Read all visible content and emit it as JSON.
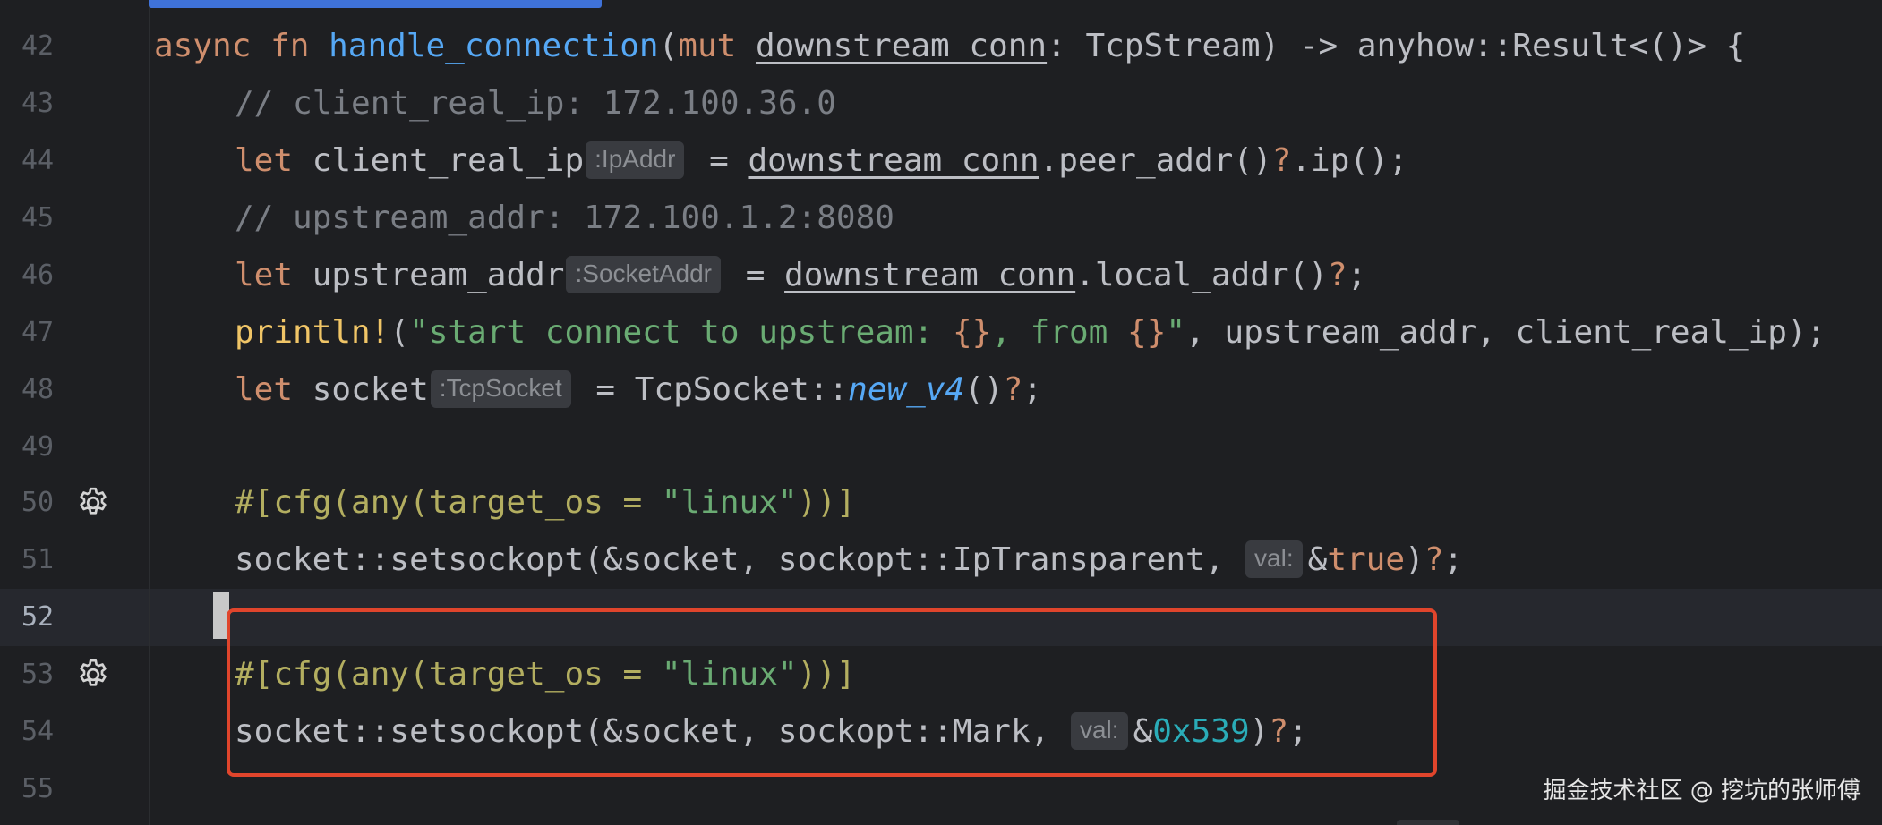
{
  "editor": {
    "line_numbers": [
      "42",
      "43",
      "44",
      "45",
      "46",
      "47",
      "48",
      "49",
      "50",
      "51",
      "52",
      "53",
      "54",
      "55"
    ],
    "current_line": "52",
    "accent_colors": {
      "highlight_box": "#e0452c",
      "scroll_indicator": "#3f72d9"
    },
    "icons": [
      "gear-icon",
      "gear-icon"
    ]
  },
  "code": {
    "l42": {
      "kw1": "async",
      "kw2": "fn",
      "fn": "handle_connection",
      "p1": "(",
      "kw3": "mut",
      "param": "downstream_conn",
      "rest": ": TcpStream) -> anyhow::Result<()> {"
    },
    "l43": {
      "comment": "// client_real_ip: 172.100.36.0"
    },
    "l44": {
      "kw": "let",
      "name": "client_real_ip",
      "hint": ":IpAddr",
      "eq": " = ",
      "recv": "downstream_conn",
      "rest1": ".peer_addr()",
      "q1": "?",
      "rest2": ".ip();"
    },
    "l45": {
      "comment": "// upstream_addr: 172.100.1.2:8080"
    },
    "l46": {
      "kw": "let",
      "name": "upstream_addr",
      "hint": ":SocketAddr",
      "eq": " = ",
      "recv": "downstream_conn",
      "rest1": ".local_addr()",
      "q1": "?",
      "rest2": ";"
    },
    "l47": {
      "macro": "println!",
      "p1": "(",
      "s1": "\"start connect to upstream: ",
      "b1": "{}",
      "s2": ", from ",
      "b2": "{}",
      "s3": "\"",
      "rest": ", upstream_addr, client_real_ip);"
    },
    "l48": {
      "kw": "let",
      "name": "socket",
      "hint": ":TcpSocket",
      "eq": " = TcpSocket::",
      "fn": "new_v4",
      "rest1": "()",
      "q1": "?",
      "rest2": ";"
    },
    "l50": {
      "attr1": "#[cfg(any(target_os = ",
      "str": "\"linux\"",
      "attr2": "))]"
    },
    "l51": {
      "pre": "socket::setsockopt(&socket, sockopt::IpTransparent, ",
      "hint": "val:",
      "amp": "&",
      "kw": "true",
      "rest": ")",
      "q1": "?",
      "end": ";"
    },
    "l53": {
      "attr1": "#[cfg(any(target_os = ",
      "str": "\"linux\"",
      "attr2": "))]"
    },
    "l54": {
      "pre": "socket::setsockopt(&socket, sockopt::Mark, ",
      "hint": "val:",
      "amp": "&",
      "num": "0x539",
      "rest": ")",
      "q1": "?",
      "end": ";"
    }
  },
  "watermark": "掘金技术社区 @ 挖坑的张师傅"
}
